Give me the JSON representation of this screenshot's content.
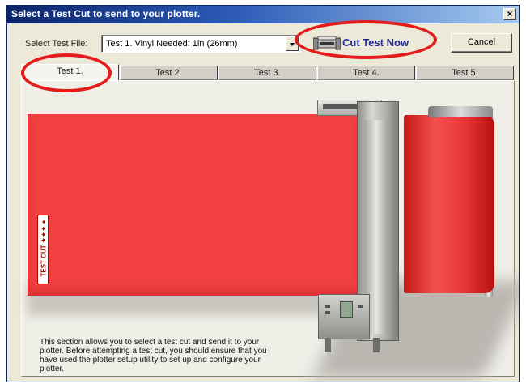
{
  "window": {
    "title": "Select a Test Cut to send to your plotter.",
    "close_glyph": "×"
  },
  "toolbar": {
    "select_label": "Select Test File:",
    "select_value": "Test 1.  Vinyl Needed: 1in (26mm)",
    "cut_now_label": "Cut Test Now",
    "cancel_label": "Cancel"
  },
  "tabs": [
    {
      "label": "Test 1.",
      "active": true
    },
    {
      "label": "Test 2."
    },
    {
      "label": "Test 3."
    },
    {
      "label": "Test 4."
    },
    {
      "label": "Test 5."
    }
  ],
  "preview": {
    "sticker_text": "TEST CUT ★★★ ●",
    "vinyl_color": "#F04040"
  },
  "description": "This section allows you to select a test cut and send it to your plotter. Before attempting a test cut, you should ensure that you have used the plotter setup utility to set up and configure your plotter.",
  "annotation_color": "#E41B1B"
}
